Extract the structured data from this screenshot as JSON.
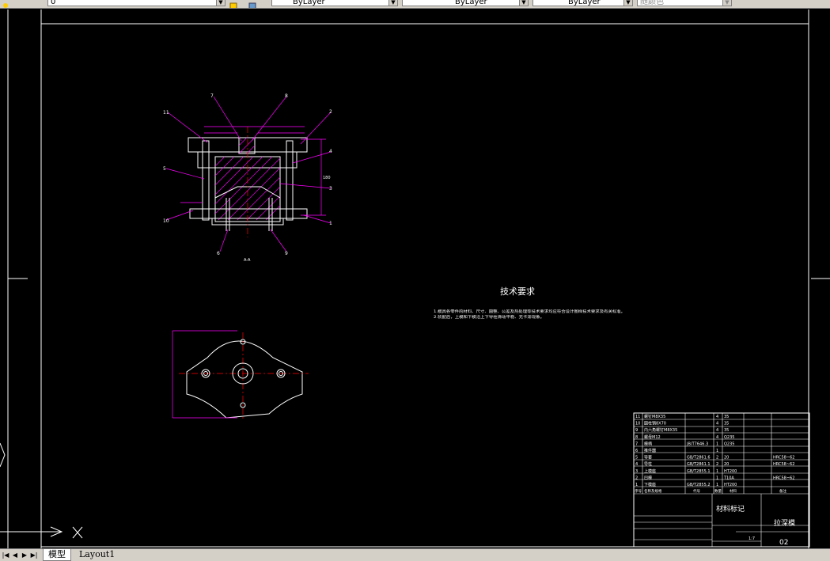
{
  "toolbar": {
    "layer_value": "0",
    "color_value": "ByLayer",
    "linetype_value": "ByLayer",
    "lineweight_value": "ByLayer",
    "plotstyle_value": "随颜色"
  },
  "drawing": {
    "section_label": "A-A",
    "tech_title": "技术要求",
    "tech_line1": "1.模具各零件的材料、尺寸、圆整、公差及热处理等技术要求均应符合设计图样技术要求及有关标准。",
    "tech_line2": "2.装配后，上模和下模沿上下导柱滑动平稳、无卡滞现象。",
    "callouts": [
      "11",
      "7",
      "8",
      "2",
      "4",
      "5",
      "3",
      "6",
      "10",
      "6",
      "9",
      "1"
    ],
    "dim_side": "180"
  },
  "bom": {
    "rows": [
      {
        "no": "11",
        "name": "螺钉M8X35",
        "std": "",
        "qty": "4",
        "mat": "35",
        "note": ""
      },
      {
        "no": "10",
        "name": "圆柱销8X70",
        "std": "",
        "qty": "4",
        "mat": "35",
        "note": ""
      },
      {
        "no": "9",
        "name": "内六角螺钉M8X35",
        "std": "",
        "qty": "4",
        "mat": "35",
        "note": ""
      },
      {
        "no": "8",
        "name": "螺母M12",
        "std": "",
        "qty": "4",
        "mat": "Q235",
        "note": ""
      },
      {
        "no": "7",
        "name": "模柄",
        "std": "JB/T7646.3",
        "qty": "1",
        "mat": "Q235",
        "note": ""
      },
      {
        "no": "6",
        "name": "推件器",
        "std": "",
        "qty": "1",
        "mat": "",
        "note": ""
      },
      {
        "no": "5",
        "name": "导套",
        "std": "GB/T2861.6",
        "qty": "2",
        "mat": "20",
        "note": "HRC58~62"
      },
      {
        "no": "4",
        "name": "导柱",
        "std": "GB/T2861.1",
        "qty": "2",
        "mat": "20",
        "note": "HRC58~62"
      },
      {
        "no": "3",
        "name": "上模座",
        "std": "GB/T2855.1",
        "qty": "1",
        "mat": "HT200",
        "note": ""
      },
      {
        "no": "2",
        "name": "凹模",
        "std": "",
        "qty": "1",
        "mat": "T10A",
        "note": "HRC58~62"
      },
      {
        "no": "1",
        "name": "下模座",
        "std": "GB/T2855.2",
        "qty": "1",
        "mat": "HT200",
        "note": ""
      }
    ],
    "header": {
      "no": "序号",
      "name": "名称及规格",
      "std": "代号",
      "qty": "数量",
      "mat": "材料",
      "note": "备注"
    },
    "material_mark": "材料标记",
    "drawing_title": "拉深模",
    "drawing_no": "02",
    "scale_box": "1:7"
  },
  "tabs": {
    "model": "模型",
    "layout": "Layout1"
  },
  "colors": {
    "magenta": "#ff00ff",
    "red": "#ff0000",
    "white": "#ffffff",
    "green": "#00ff00",
    "gray": "#808080"
  }
}
